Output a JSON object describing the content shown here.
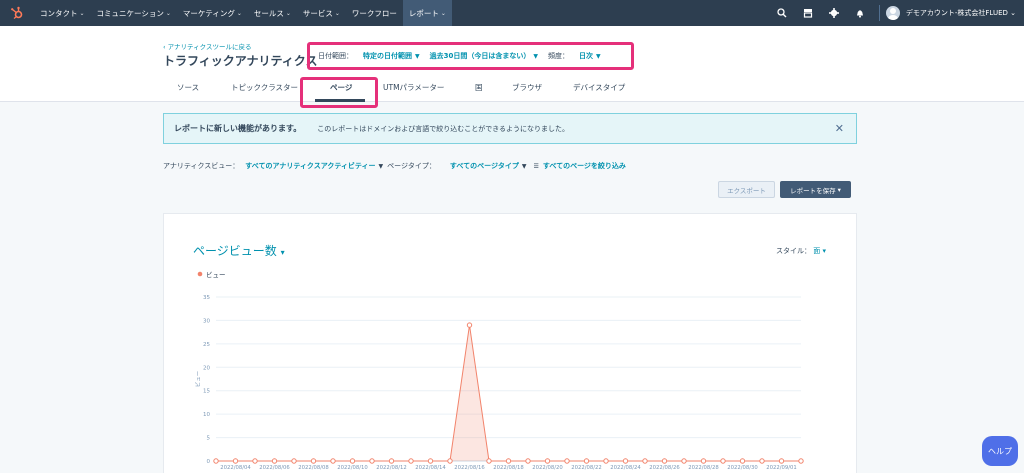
{
  "nav": {
    "items": [
      {
        "label": "コンタクト",
        "dropdown": true
      },
      {
        "label": "コミュニケーション",
        "dropdown": true
      },
      {
        "label": "マーケティング",
        "dropdown": true
      },
      {
        "label": "セールス",
        "dropdown": true
      },
      {
        "label": "サービス",
        "dropdown": true
      },
      {
        "label": "ワークフロー",
        "dropdown": false
      },
      {
        "label": "レポート",
        "dropdown": true,
        "active": true
      }
    ],
    "account": "デモアカウント-株式会社FLUED",
    "bg_color": "#2d3e50"
  },
  "header": {
    "back_link": "‹ アナリティクスツールに戻る",
    "title": "トラフィックアナリティクス",
    "filters": {
      "date_range_label": "日付範囲：",
      "date_range_value": "特定の日付範囲",
      "period_value": "過去30日間（今日は含まない）",
      "frequency_label": "頻度：",
      "frequency_value": "日次"
    },
    "tabs": [
      "ソース",
      "トピッククラスター",
      "ページ",
      "UTMパラメーター",
      "国",
      "ブラウザ",
      "デバイスタイプ"
    ],
    "active_tab": "ページ"
  },
  "alert": {
    "title": "レポートに新しい機能があります。",
    "text": "このレポートはドメインおよび言語で絞り込むことができるようになりました。"
  },
  "filters2": {
    "view_label": "アナリティクスビュー：",
    "view_value": "すべてのアナリティクスアクティビティー",
    "page_type_label": "ページタイプ：",
    "page_type_value": "すべてのページタイプ",
    "filter_pages": "すべてのページを絞り込み"
  },
  "actions": {
    "export": "エクスポート",
    "save": "レポートを保存"
  },
  "chart_card": {
    "title": "ページビュー数",
    "style_label": "スタイル：",
    "style_value": "面"
  },
  "help": "ヘルプ",
  "chart_data": {
    "type": "area",
    "legend": [
      "ビュー"
    ],
    "ylabel": "ビュー",
    "ylim": [
      0,
      35
    ],
    "yticks": [
      0,
      5,
      10,
      15,
      20,
      25,
      30,
      35
    ],
    "x_tick_labels": [
      "2022/08/04",
      "2022/08/06",
      "2022/08/08",
      "2022/08/10",
      "2022/08/12",
      "2022/08/14",
      "2022/08/16",
      "2022/08/18",
      "2022/08/20",
      "2022/08/22",
      "2022/08/24",
      "2022/08/26",
      "2022/08/28",
      "2022/08/30",
      "2022/09/01"
    ],
    "series": [
      {
        "name": "ビュー",
        "color": "#f2836b",
        "x": [
          "2022/08/03",
          "2022/08/04",
          "2022/08/05",
          "2022/08/06",
          "2022/08/07",
          "2022/08/08",
          "2022/08/09",
          "2022/08/10",
          "2022/08/11",
          "2022/08/12",
          "2022/08/13",
          "2022/08/14",
          "2022/08/15",
          "2022/08/16",
          "2022/08/17",
          "2022/08/18",
          "2022/08/19",
          "2022/08/20",
          "2022/08/21",
          "2022/08/22",
          "2022/08/23",
          "2022/08/24",
          "2022/08/25",
          "2022/08/26",
          "2022/08/27",
          "2022/08/28",
          "2022/08/29",
          "2022/08/30",
          "2022/08/31",
          "2022/09/01",
          "2022/09/02"
        ],
        "values": [
          0,
          0,
          0,
          0,
          0,
          0,
          0,
          0,
          0,
          0,
          0,
          0,
          0,
          29,
          0,
          0,
          0,
          0,
          0,
          0,
          0,
          0,
          0,
          0,
          0,
          0,
          0,
          0,
          0,
          0,
          0
        ]
      }
    ]
  }
}
